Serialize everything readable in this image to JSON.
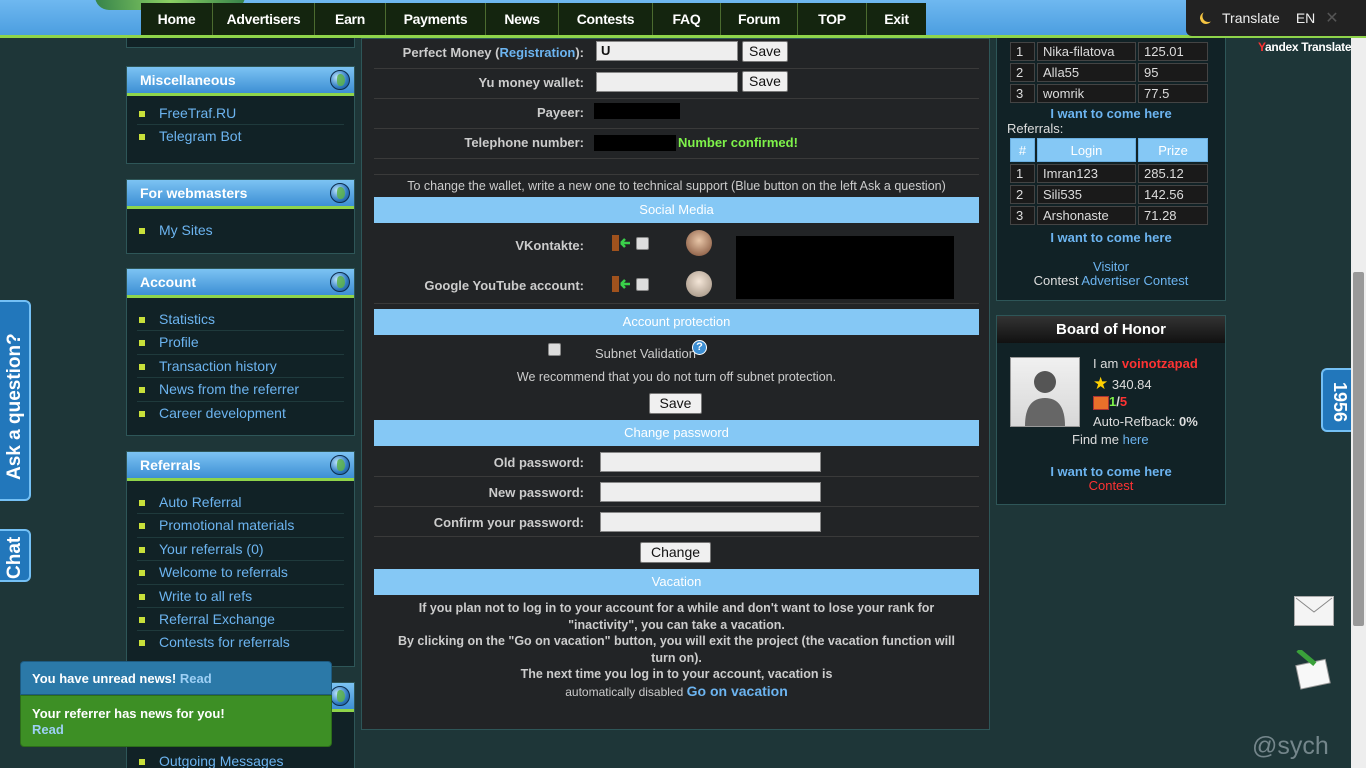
{
  "nav": [
    "Home",
    "Advertisers",
    "Earn",
    "Payments",
    "News",
    "Contests",
    "FAQ",
    "Forum",
    "TOP",
    "Exit"
  ],
  "translate": {
    "label": "Translate",
    "lang": "EN",
    "close": "✕",
    "brand_y": "Y",
    "brand_rest": "andex Translate"
  },
  "sidebar": {
    "misc": {
      "title": "Miscellaneous",
      "items": [
        "FreeTraf.RU",
        "Telegram Bot"
      ]
    },
    "webmasters": {
      "title": "For webmasters",
      "items": [
        "My Sites"
      ]
    },
    "account": {
      "title": "Account",
      "items": [
        "Statistics",
        "Profile",
        "Transaction history",
        "News from the referrer",
        "Career development"
      ]
    },
    "referrals": {
      "title": "Referrals",
      "items": [
        "Auto Referral",
        "Promotional materials",
        "Your referrals (0)",
        "Welcome to referrals",
        "Write to all refs",
        "Referral Exchange",
        "Contests for referrals"
      ]
    },
    "last_item": "Outgoing Messages"
  },
  "wallets": {
    "perfect_money_label_a": "Perfect Money (",
    "perfect_money_link": "Registration",
    "perfect_money_label_b": "):",
    "perfect_money_value": "U",
    "yu_label": "Yu money wallet:",
    "yu_value": "",
    "payeer_label": "Payeer:",
    "phone_label": "Telephone number:",
    "phone_status": "Number confirmed!",
    "save": "Save",
    "change_note": "To change the wallet, write a new one to technical support (Blue button on the left Ask a question)"
  },
  "social": {
    "title": "Social Media",
    "vk_label": "VKontakte:",
    "yt_label": "Google YouTube account:"
  },
  "protection": {
    "title": "Account protection",
    "subnet_label": "Subnet Validation",
    "help": "?",
    "note": "We recommend that you do not turn off subnet protection.",
    "save": "Save"
  },
  "password": {
    "title": "Change password",
    "old": "Old password:",
    "new": "New password:",
    "confirm": "Confirm your password:",
    "button": "Change"
  },
  "vacation": {
    "title": "Vacation",
    "line1": "If you plan not to log in to your account for a while and don't want to lose your rank for",
    "line2": "\"inactivity\", you can take a vacation.",
    "line3": "By clicking on the \"Go on vacation\" button, you will exit the project (the vacation function will",
    "line4": "turn on).",
    "line5": "The next time you log in to your account, vacation is",
    "line6": "automatically disabled",
    "link": "Go on vacation"
  },
  "contest": {
    "top_rows": [
      [
        "1",
        "Nika-filatova",
        "125.01"
      ],
      [
        "2",
        "Alla55",
        "95"
      ],
      [
        "3",
        "womrik",
        "77.5"
      ]
    ],
    "come_here": "I want to come here",
    "referrals_label": "Referrals:",
    "ref_headers": [
      "#",
      "Login",
      "Prize"
    ],
    "ref_rows": [
      [
        "1",
        "Imran123",
        "285.12"
      ],
      [
        "2",
        "Sili535",
        "142.56"
      ],
      [
        "3",
        "Arshonaste",
        "71.28"
      ]
    ],
    "visitor": "Visitor",
    "contest_word": "Contest",
    "advertiser_contest": "Advertiser Contest"
  },
  "honor": {
    "title": "Board of Honor",
    "i_am": "I am",
    "user": "voinotzapad",
    "stars": "340.84",
    "level_a": "1",
    "level_sep": "/",
    "level_b": "5",
    "refback_label": "Auto-Refback:",
    "refback_value": "0%",
    "find_me": "Find me",
    "here": "here",
    "come_here": "I want to come here",
    "contest": "Contest"
  },
  "tabs": {
    "ask": "Ask a question?",
    "chat": "Chat",
    "counter": "1956"
  },
  "notifications": {
    "unread": "You have unread news!",
    "read": "Read",
    "referrer": "Your referrer has news for you!",
    "read2": "Read"
  },
  "watermark": "@sych",
  "colors": {
    "accent_blue": "#85c8f5",
    "link": "#6cb4f0",
    "green_ok": "#7ef24a",
    "red": "#ff3333",
    "nav_bg": "#14250f"
  }
}
